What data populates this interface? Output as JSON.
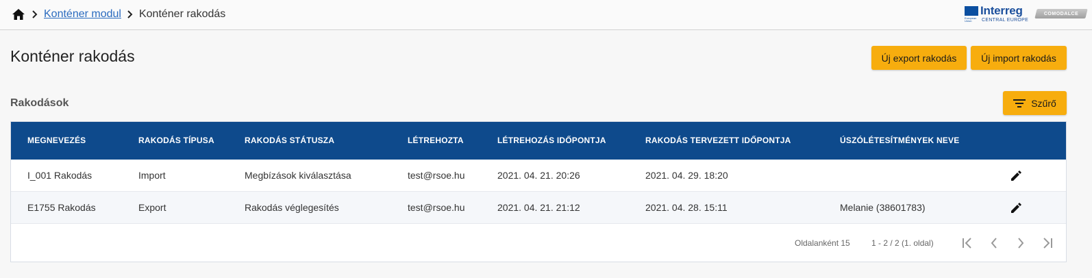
{
  "breadcrumb": {
    "home_icon": "home-icon",
    "separator_icon": "chevron-right-icon",
    "module_link": "Konténer modul",
    "current": "Konténer rakodás"
  },
  "logo": {
    "brand": "Interreg",
    "subtitle": "CENTRAL EUROPE",
    "badge": "COMODALCE",
    "eu_text": "European Union"
  },
  "page": {
    "title": "Konténer rakodás",
    "new_export_label": "Új export rakodás",
    "new_import_label": "Új import rakodás"
  },
  "section": {
    "title": "Rakodások",
    "filter_label": "Szűrő",
    "filter_icon": "filter-list-icon"
  },
  "table": {
    "columns": [
      "MEGNEVEZÉS",
      "RAKODÁS TÍPUSA",
      "RAKODÁS STÁTUSZA",
      "LÉTREHOZTA",
      "LÉTREHOZÁS IDŐPONTJA",
      "RAKODÁS TERVEZETT IDŐPONTJA",
      "ÚSZÓLÉTESÍTMÉNYEK NEVE"
    ],
    "rows": [
      [
        "I_001 Rakodás",
        "Import",
        "Megbízások kiválasztása",
        "test@rsoe.hu",
        "2021. 04. 21. 20:26",
        "2021. 04. 29. 18:20",
        ""
      ],
      [
        "E1755 Rakodás",
        "Export",
        "Rakodás véglegesítés",
        "test@rsoe.hu",
        "2021. 04. 21. 21:12",
        "2021. 04. 28. 15:11",
        "Melanie (38601783)"
      ]
    ],
    "row_action_icon": "pencil-edit-icon"
  },
  "pagination": {
    "per_page": "Oldalanként 15",
    "range": "1 - 2 / 2 (1. oldal)",
    "icons": [
      "first-page-icon",
      "prev-page-icon",
      "next-page-icon",
      "last-page-icon"
    ]
  },
  "colors": {
    "accent": "#f7ad0e",
    "header": "#0e4a8c",
    "link": "#2a6bbf"
  }
}
